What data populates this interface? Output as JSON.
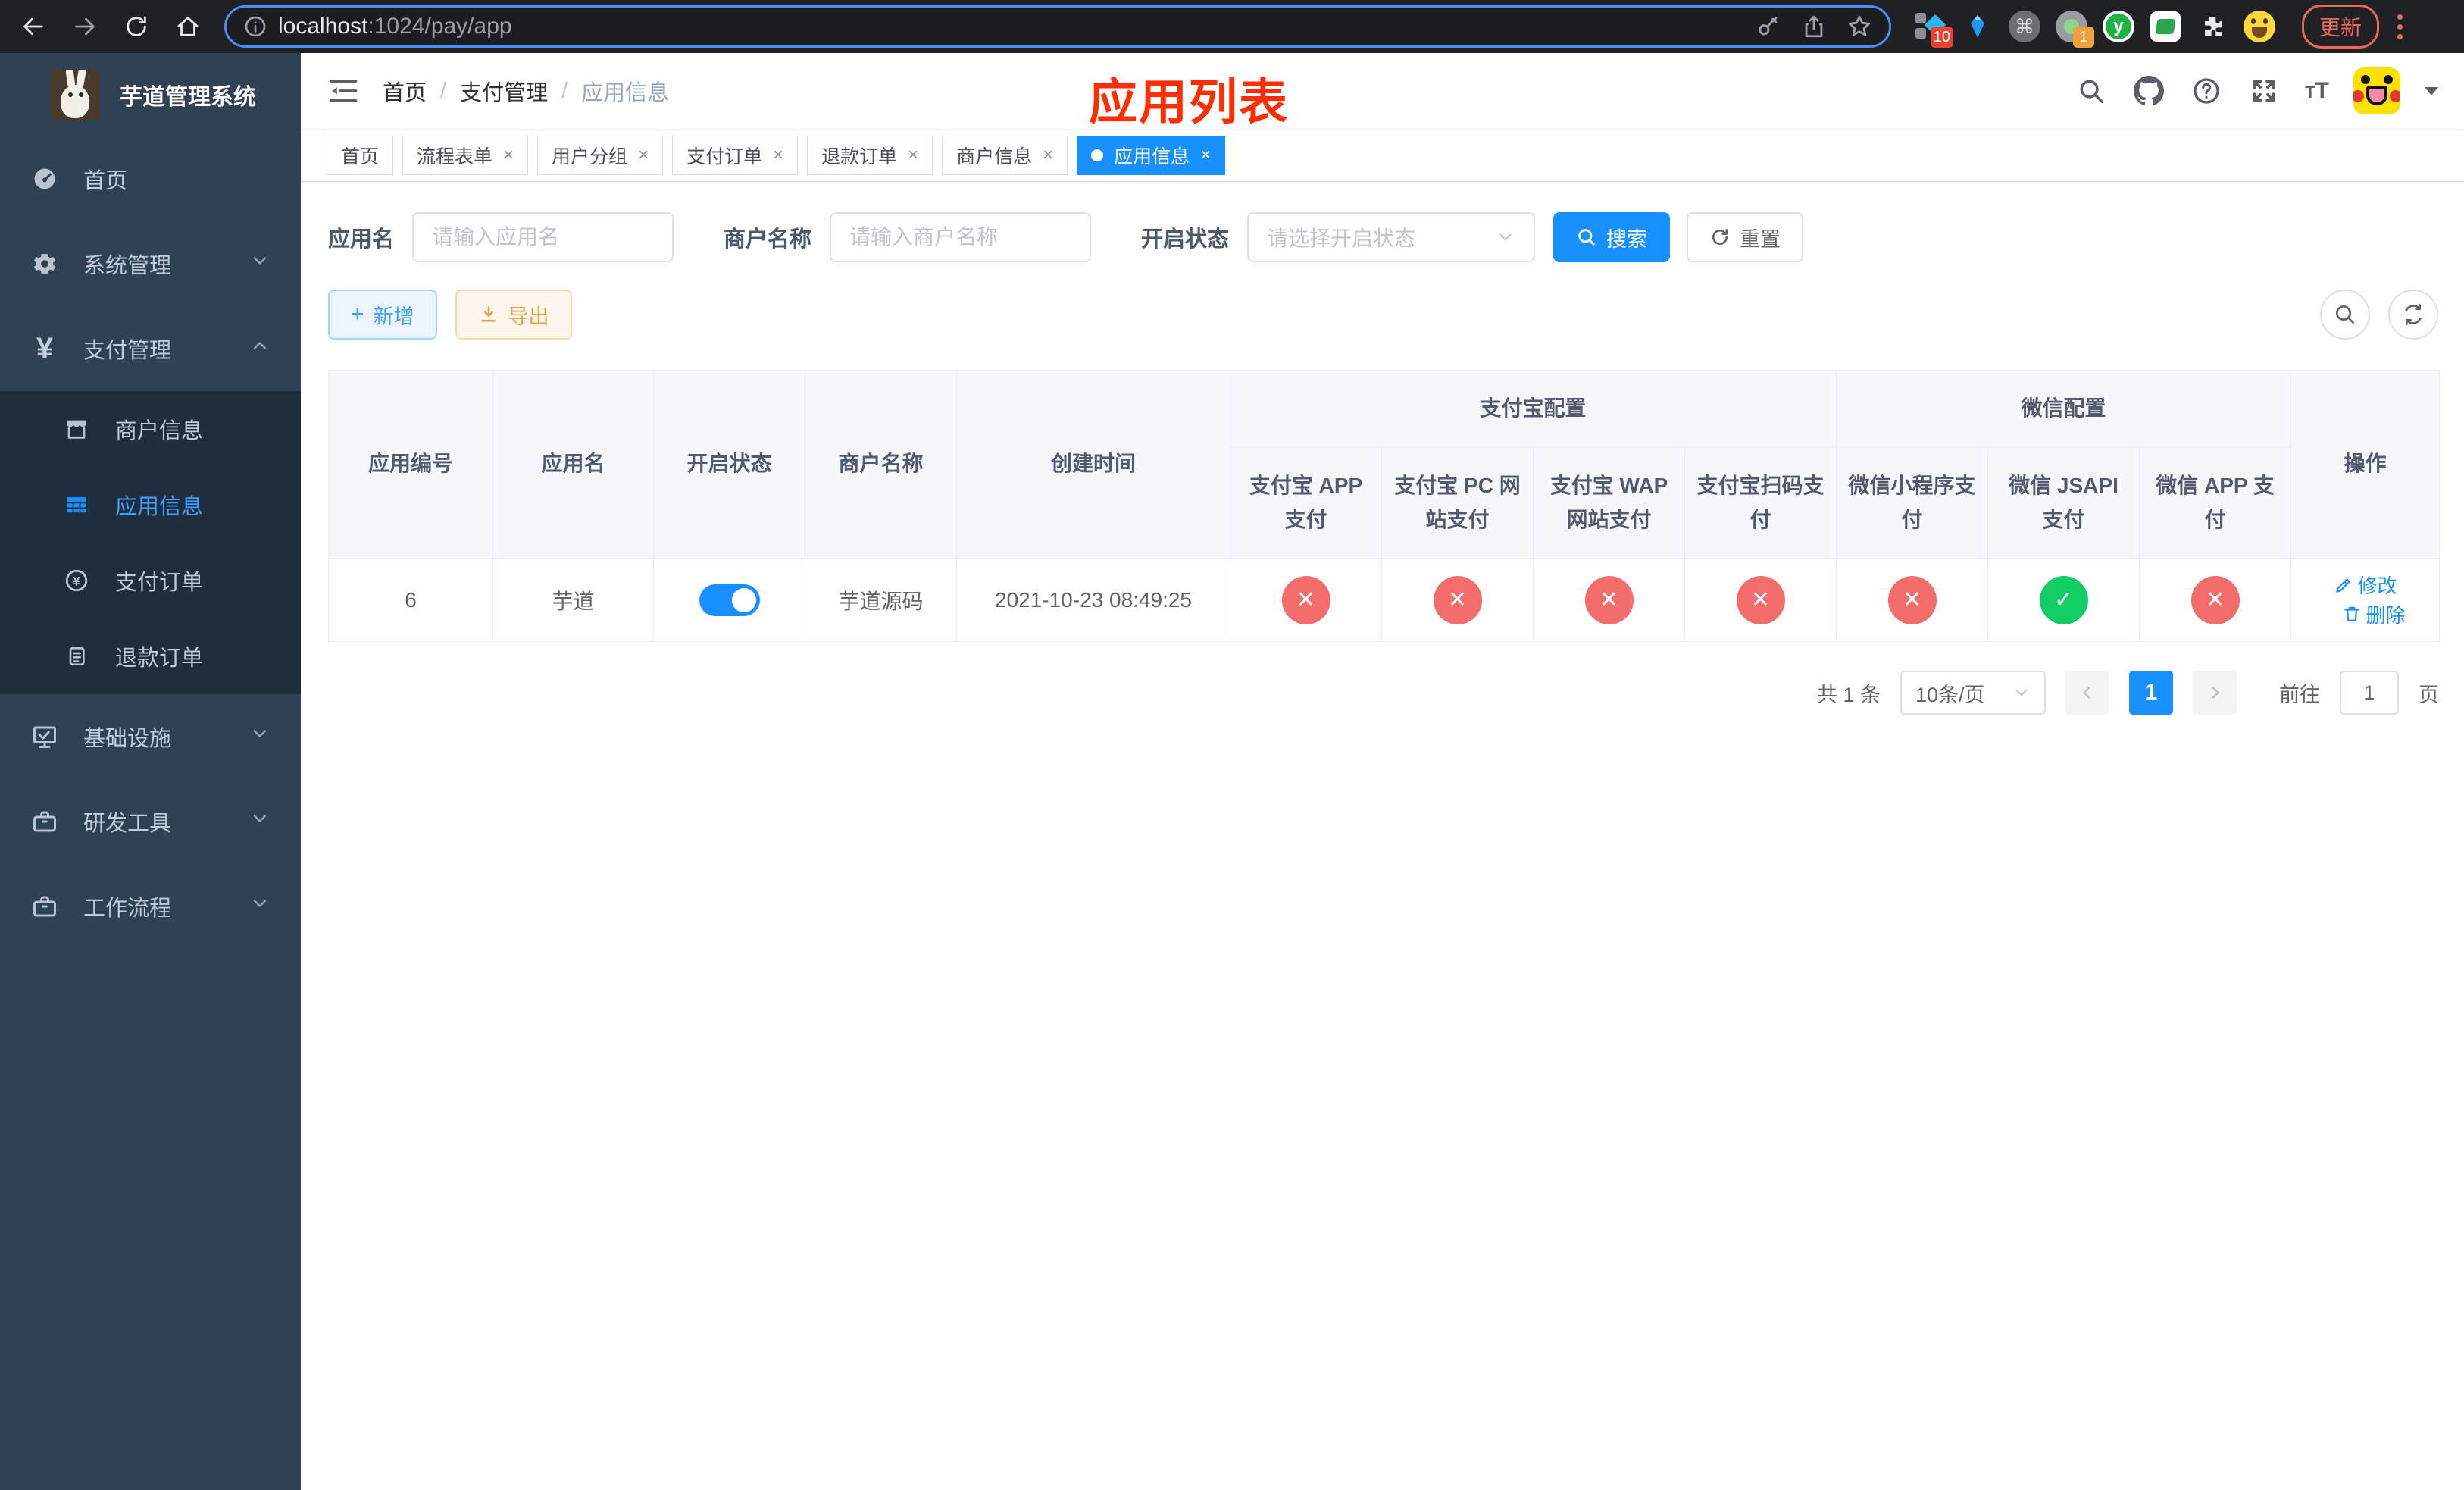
{
  "browser": {
    "url": {
      "host": "localhost",
      "rest": ":1024/pay/app"
    },
    "update_label": "更新",
    "ext_badges": {
      "pinned": "10",
      "profile": "1"
    },
    "icons": [
      "back",
      "forward",
      "reload",
      "home",
      "info",
      "key",
      "share",
      "star",
      "extensions",
      "avatar-emoji"
    ]
  },
  "sidebar": {
    "title": "芋道管理系统",
    "items": [
      {
        "label": "首页"
      },
      {
        "label": "系统管理"
      },
      {
        "label": "支付管理"
      },
      {
        "label": "商户信息"
      },
      {
        "label": "应用信息"
      },
      {
        "label": "支付订单"
      },
      {
        "label": "退款订单"
      },
      {
        "label": "基础设施"
      },
      {
        "label": "研发工具"
      },
      {
        "label": "工作流程"
      }
    ]
  },
  "header": {
    "breadcrumb": {
      "home": "首页",
      "section": "支付管理",
      "current": "应用信息"
    },
    "annotation": "应用列表"
  },
  "tabs": [
    {
      "label": "首页"
    },
    {
      "label": "流程表单"
    },
    {
      "label": "用户分组"
    },
    {
      "label": "支付订单"
    },
    {
      "label": "退款订单"
    },
    {
      "label": "商户信息"
    },
    {
      "label": "应用信息"
    }
  ],
  "filters": {
    "app_name_label": "应用名",
    "app_name_placeholder": "请输入应用名",
    "merchant_label": "商户名称",
    "merchant_placeholder": "请输入商户名称",
    "status_label": "开启状态",
    "status_placeholder": "请选择开启状态",
    "search_label": "搜索",
    "reset_label": "重置"
  },
  "toolbar": {
    "add_label": "新增",
    "export_label": "导出"
  },
  "table": {
    "headers": {
      "id": "应用编号",
      "name": "应用名",
      "status": "开启状态",
      "merchant": "商户名称",
      "created": "创建时间",
      "alipay_group": "支付宝配置",
      "wechat_group": "微信配置",
      "alipay_app": "支付宝 APP 支付",
      "alipay_pc": "支付宝 PC 网站支付",
      "alipay_wap": "支付宝 WAP 网站支付",
      "alipay_qr": "支付宝扫码支付",
      "wx_mini": "微信小程序支付",
      "wx_jsapi": "微信 JSAPI 支付",
      "wx_app": "微信 APP 支付",
      "actions": "操作"
    },
    "row": {
      "id": "6",
      "name": "芋道",
      "status_on": true,
      "merchant": "芋道源码",
      "created": "2021-10-23 08:49:25",
      "alipay_app": "disabled",
      "alipay_pc": "disabled",
      "alipay_wap": "disabled",
      "alipay_qr": "disabled",
      "wx_mini": "disabled",
      "wx_jsapi": "enabled",
      "wx_app": "disabled",
      "edit_label": "修改",
      "delete_label": "删除"
    }
  },
  "pagination": {
    "total": "共 1 条",
    "page_size": "10条/页",
    "page": "1",
    "goto_prefix": "前往",
    "goto_value": "1",
    "goto_suffix": "页"
  },
  "colors": {
    "primary": "#1890ff",
    "sidebar_bg": "#304156",
    "submenu_bg": "#1f2d3d",
    "danger": "#f56c6c",
    "success": "#13ce66",
    "annotation_red": "#ff2d00",
    "export_orange": "#e6a23c"
  }
}
